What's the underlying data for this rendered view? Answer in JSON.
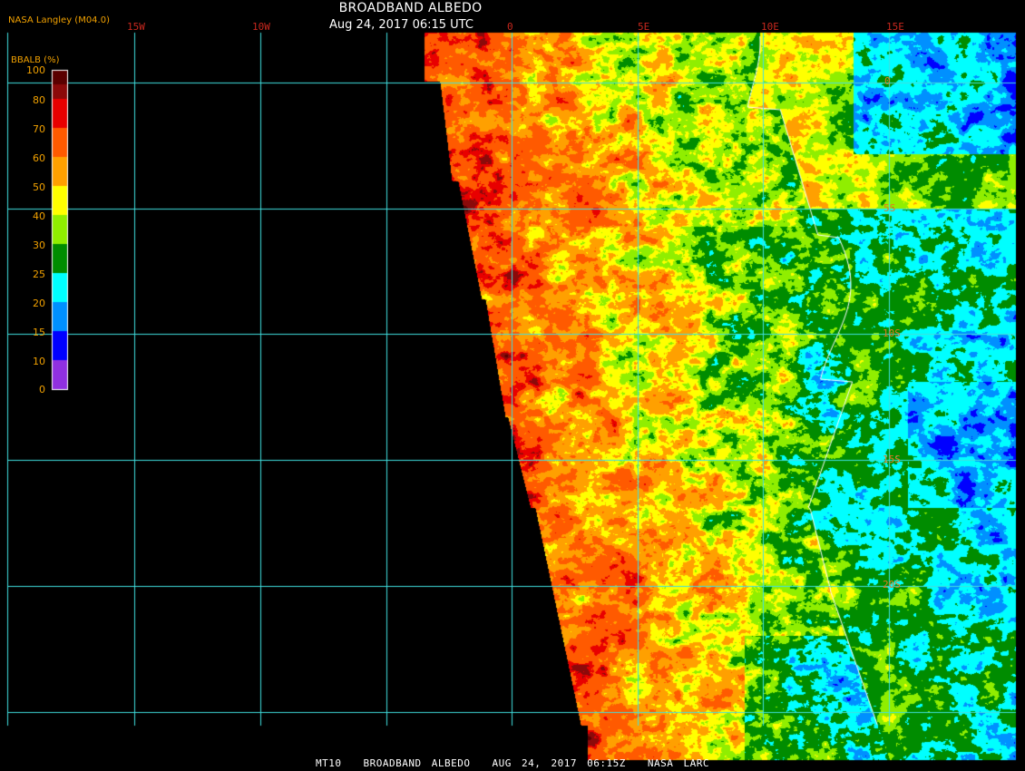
{
  "header": {
    "credit": "NASA Langley (M04.0)",
    "title": "BROADBAND ALBEDO",
    "timestamp": "Aug 24, 2017 06:15 UTC"
  },
  "legend": {
    "title": "BBALB (%)",
    "ticks": [
      "100",
      "80",
      "70",
      "60",
      "50",
      "40",
      "30",
      "25",
      "20",
      "15",
      "10",
      "0"
    ],
    "colors": [
      "#5a0000",
      "#8b0a0a",
      "#e80000",
      "#ff5a00",
      "#ffa000",
      "#ffff00",
      "#90ee00",
      "#008c00",
      "#00ffff",
      "#0090ff",
      "#0000ff",
      "#9030e0"
    ]
  },
  "grid": {
    "lon_labels": [
      "15W",
      "10W",
      "0",
      "5E",
      "10E",
      "15E"
    ],
    "lat_labels": [
      "0",
      "5S",
      "10S",
      "15S",
      "20S"
    ],
    "line_color": "#40e0e0"
  },
  "footer": {
    "product": "MT10",
    "name": "BROADBAND ALBEDO",
    "date": "AUG 24, 2017 06:15Z",
    "source": "NASA LARC"
  }
}
